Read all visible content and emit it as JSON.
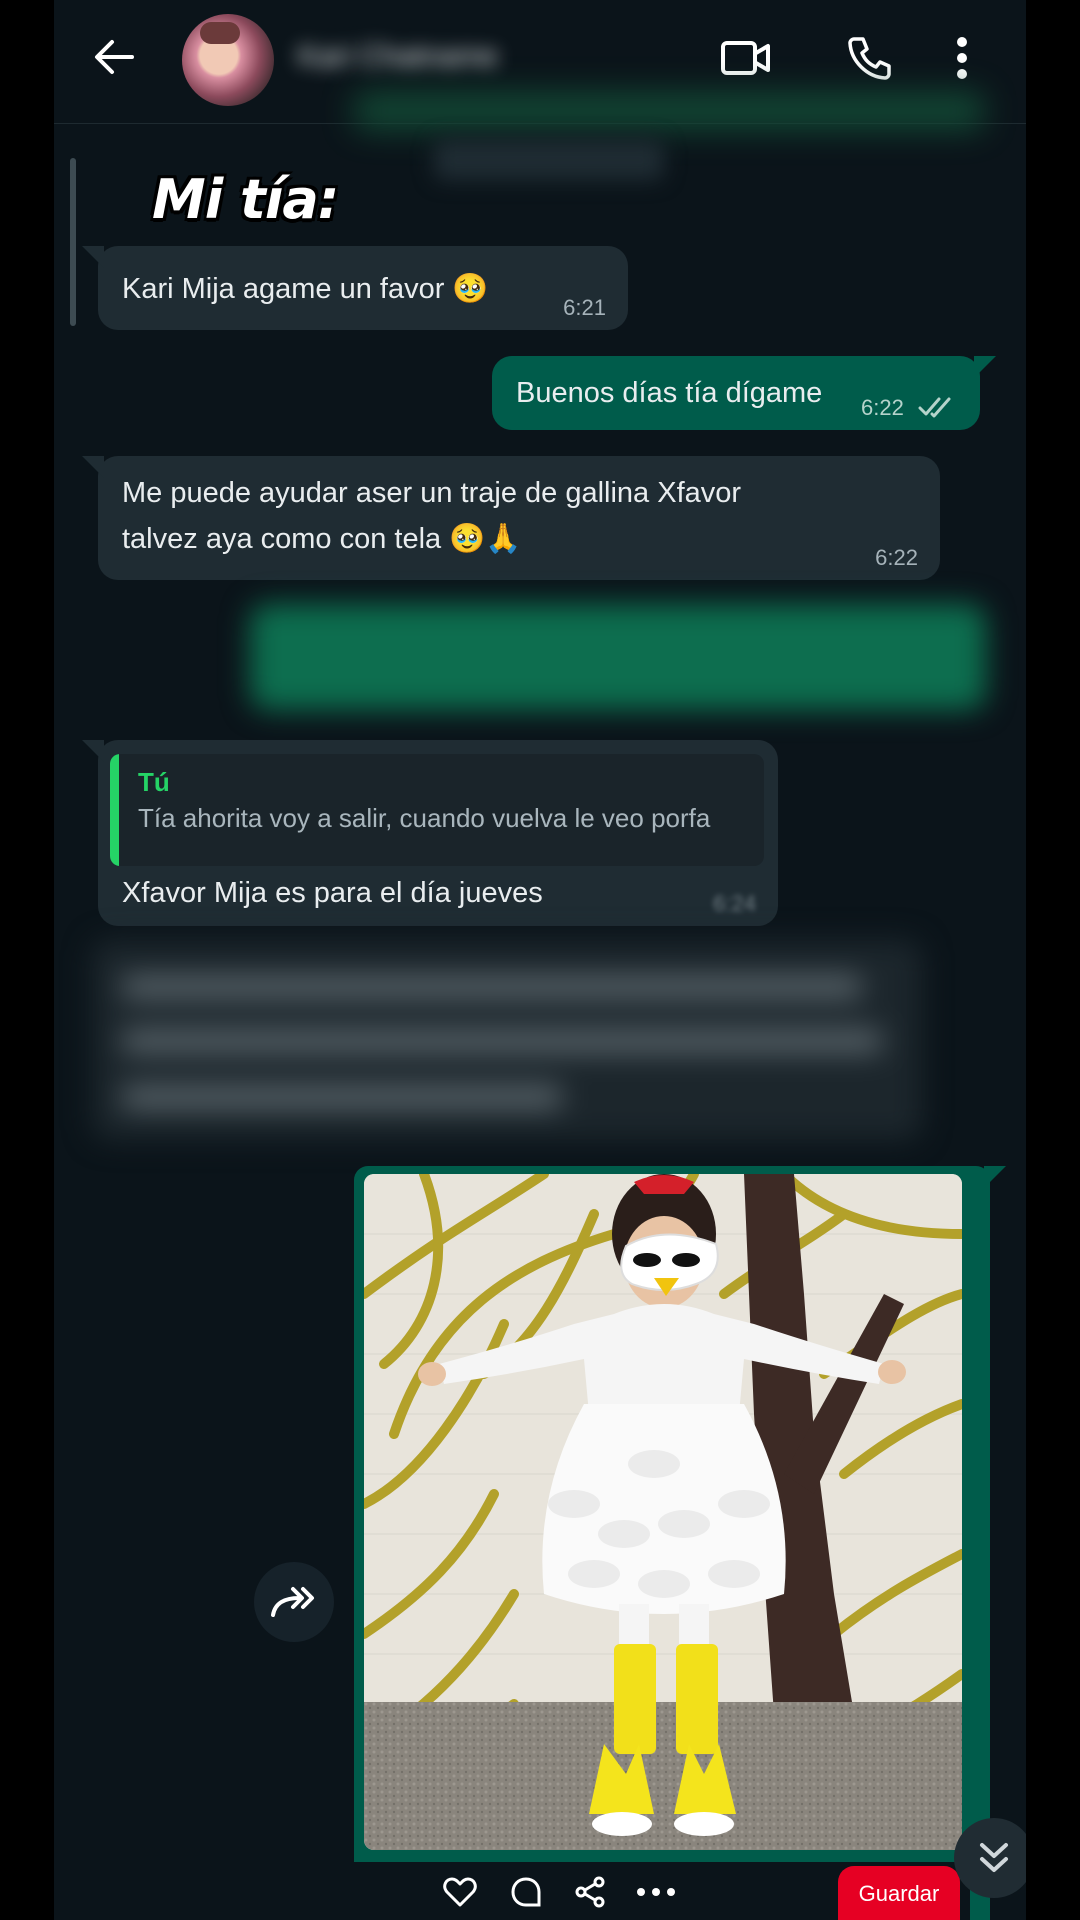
{
  "header": {
    "contact_name": "Kari Chatname",
    "icons": [
      "back-arrow-icon",
      "video-call-icon",
      "phone-icon",
      "more-vert-icon"
    ]
  },
  "overlay_title": "Mi tía:",
  "messages": [
    {
      "direction": "in",
      "text": "Kari Mija agame un favor 🥹",
      "time": "6:21"
    },
    {
      "direction": "out",
      "text": "Buenos días tía dígame",
      "time": "6:22",
      "status": "read"
    },
    {
      "direction": "in",
      "text_line1": "Me puede ayudar aser un traje de gallina Xfavor",
      "text_line2": "talvez aya como con tela 🥹🙏",
      "time": "6:22"
    },
    {
      "direction": "in",
      "quote_author": "Tú",
      "quote_text": "Tía ahorita voy a salir, cuando vuelva le veo porfa",
      "text": "Xfavor Mija es para el día jueves",
      "time": "6:24"
    }
  ],
  "image_message": {
    "alt": "Niña con disfraz de gallina blanca",
    "pin_actions": [
      "heart-icon",
      "comment-icon",
      "share-icon",
      "more-horiz-icon"
    ],
    "save_label": "Guardar"
  },
  "colors": {
    "background": "#0b141a",
    "incoming_bubble": "#1f2c33",
    "outgoing_bubble": "#005c4b",
    "accent_green": "#25d366",
    "pin_red": "#e60023"
  }
}
